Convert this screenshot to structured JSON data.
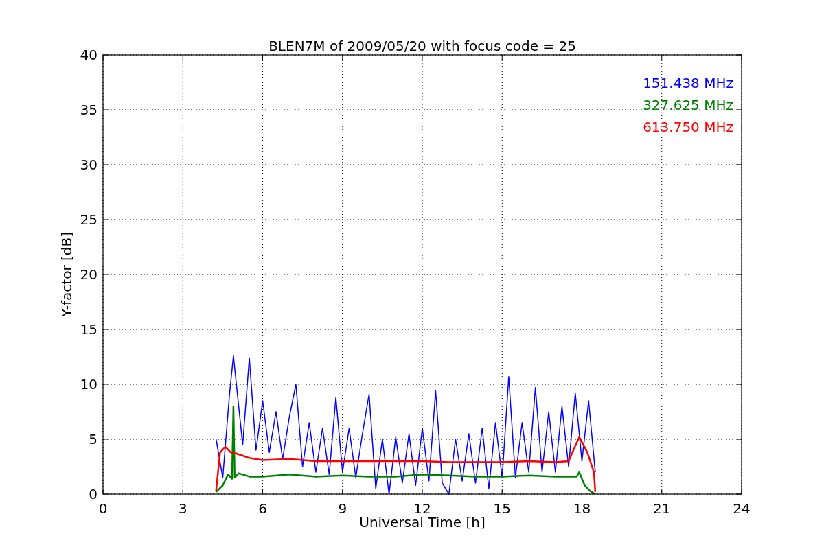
{
  "chart_data": {
    "type": "line",
    "grid": true,
    "title": "BLEN7M of 2009/05/20 with focus code = 25",
    "xlabel": "Universal Time [h]",
    "ylabel": "Y-factor [dB]",
    "xlim": [
      0,
      24
    ],
    "ylim": [
      0,
      40
    ],
    "xticks": [
      0,
      3,
      6,
      9,
      12,
      15,
      18,
      21,
      24
    ],
    "yticks": [
      0,
      5,
      10,
      15,
      20,
      25,
      30,
      35,
      40
    ],
    "series": [
      {
        "name": "151.438 MHz",
        "color": "#0000ff",
        "x": [
          4.25,
          4.5,
          4.75,
          4.9,
          5.25,
          5.5,
          5.75,
          6.0,
          6.25,
          6.5,
          6.75,
          7.0,
          7.25,
          7.5,
          7.75,
          8.0,
          8.25,
          8.5,
          8.75,
          9.0,
          9.25,
          9.5,
          9.75,
          10.0,
          10.25,
          10.5,
          10.75,
          11.0,
          11.25,
          11.5,
          11.75,
          12.0,
          12.25,
          12.5,
          12.75,
          13.0,
          13.25,
          13.5,
          13.75,
          14.0,
          14.25,
          14.5,
          14.75,
          15.0,
          15.25,
          15.5,
          15.75,
          16.0,
          16.25,
          16.5,
          16.75,
          17.0,
          17.25,
          17.5,
          17.75,
          18.0,
          18.25,
          18.5
        ],
        "values": [
          5.0,
          1.5,
          9.0,
          12.6,
          4.5,
          12.4,
          4.0,
          8.5,
          3.8,
          7.5,
          3.2,
          7.0,
          10.0,
          2.5,
          6.5,
          2.0,
          6.0,
          1.8,
          8.8,
          2.0,
          6.0,
          1.5,
          5.5,
          9.1,
          0.5,
          5.0,
          0.0,
          5.2,
          1.0,
          5.5,
          0.8,
          6.0,
          1.2,
          9.4,
          1.0,
          0.0,
          5.0,
          1.2,
          5.5,
          1.0,
          6.0,
          0.5,
          6.5,
          1.5,
          10.7,
          1.5,
          6.5,
          2.0,
          9.7,
          2.0,
          7.5,
          2.0,
          8.0,
          2.5,
          9.2,
          3.0,
          8.5,
          2.0
        ]
      },
      {
        "name": "327.625 MHz",
        "color": "#008000",
        "x": [
          4.25,
          4.5,
          4.7,
          4.85,
          4.9,
          4.95,
          5.1,
          5.5,
          6,
          7,
          8,
          9,
          10,
          11,
          12,
          13,
          14,
          15,
          16,
          17,
          17.8,
          17.9,
          18.1,
          18.3,
          18.5
        ],
        "values": [
          0.2,
          0.8,
          1.8,
          1.4,
          8.0,
          1.5,
          1.9,
          1.6,
          1.6,
          1.8,
          1.6,
          1.7,
          1.6,
          1.6,
          1.8,
          1.7,
          1.6,
          1.6,
          1.7,
          1.6,
          1.6,
          2.0,
          0.8,
          0.3,
          0.0
        ]
      },
      {
        "name": "613.750 MHz",
        "color": "#ff0000",
        "x": [
          4.25,
          4.4,
          4.6,
          4.8,
          5,
          5.5,
          6,
          7,
          8,
          9,
          10,
          11,
          12,
          13,
          14,
          15,
          16,
          17,
          17.5,
          17.9,
          18.2,
          18.45,
          18.5
        ],
        "values": [
          0.3,
          3.8,
          4.3,
          3.8,
          3.7,
          3.3,
          3.1,
          3.2,
          3.0,
          3.0,
          3.0,
          3.0,
          3.0,
          2.9,
          2.9,
          2.9,
          3.0,
          2.9,
          3.0,
          5.2,
          3.8,
          2.0,
          0.2
        ]
      }
    ]
  }
}
